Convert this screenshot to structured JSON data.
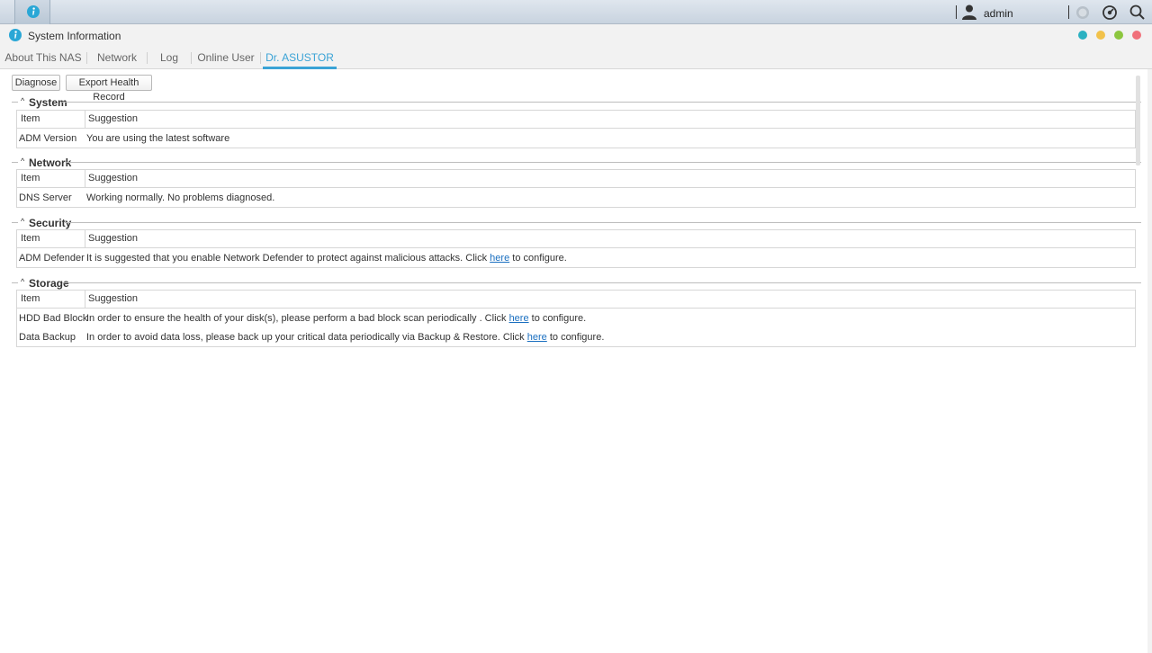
{
  "taskbar": {
    "app_icon": "info-icon",
    "user": {
      "icon": "user-icon",
      "name": "admin"
    },
    "buttons": [
      "notification-icon",
      "settings-dial-icon",
      "search-icon"
    ]
  },
  "window": {
    "title": "System Information",
    "icon": "info-icon",
    "controls": [
      {
        "name": "window-minimize-dot",
        "color": "#2bb1c1"
      },
      {
        "name": "window-restore-dot",
        "color": "#f2c24a"
      },
      {
        "name": "window-maximize-dot",
        "color": "#8cc63e"
      },
      {
        "name": "window-close-dot",
        "color": "#f0707a"
      }
    ],
    "accent": "#3aa3d6"
  },
  "tabs": [
    {
      "label": "About This NAS",
      "active": false
    },
    {
      "label": "Network",
      "active": false
    },
    {
      "label": "Log",
      "active": false
    },
    {
      "label": "Online User",
      "active": false
    },
    {
      "label": "Dr. ASUSTOR",
      "active": true
    }
  ],
  "toolbar": {
    "diagnose_label": "Diagnose",
    "export_label": "Export Health Record"
  },
  "sections": [
    {
      "title": "System",
      "headers": [
        "Item",
        "Suggestion"
      ],
      "rows": [
        {
          "item": "ADM Version",
          "suggestion": "You are using the latest software"
        }
      ]
    },
    {
      "title": "Network",
      "headers": [
        "Item",
        "Suggestion"
      ],
      "rows": [
        {
          "item": "DNS Server",
          "suggestion": "Working normally. No problems diagnosed."
        }
      ]
    },
    {
      "title": "Security",
      "headers": [
        "Item",
        "Suggestion"
      ],
      "rows": [
        {
          "item": "ADM Defender",
          "suggestion_before": "It is suggested that you enable Network Defender to protect against malicious attacks. Click ",
          "link": "here",
          "suggestion_after": " to configure."
        }
      ]
    },
    {
      "title": "Storage",
      "headers": [
        "Item",
        "Suggestion"
      ],
      "rows": [
        {
          "item": "HDD Bad Block",
          "suggestion_before": "In order to ensure the health of your disk(s), please perform a bad block scan periodically . Click ",
          "link": "here",
          "suggestion_after": " to configure."
        },
        {
          "item": "Data Backup",
          "suggestion_before": "In order to avoid data loss, please back up your critical data periodically via Backup & Restore. Click ",
          "link": "here",
          "suggestion_after": " to configure."
        }
      ]
    }
  ]
}
